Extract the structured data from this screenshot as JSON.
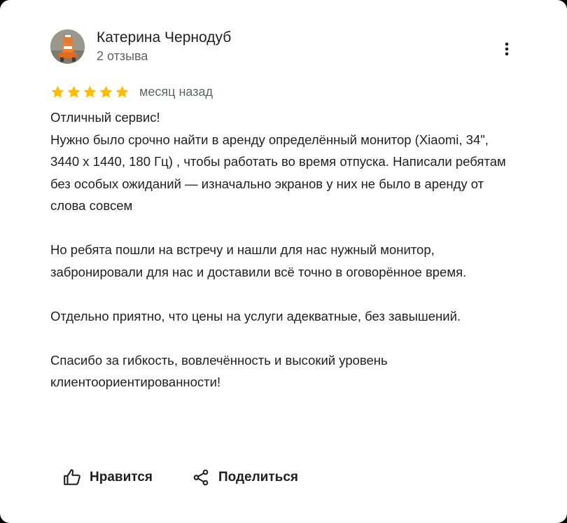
{
  "review": {
    "author": {
      "name": "Катерина Чернодуб",
      "reviews_count": "2 отзыва"
    },
    "rating": 5,
    "time": "месяц назад",
    "paragraphs": [
      {
        "lines": [
          "Отличный сервис!",
          "Нужно было срочно найти в аренду определённый монитор (Xiaomi, 34\", 3440 x 1440, 180 Гц) , чтобы работать во время отпуска. Написали ребятам без особых ожиданий — изначально экранов у них не было в аренду от слова совсем"
        ]
      },
      {
        "lines": [
          "Но ребята пошли на встречу и нашли для нас нужный монитор, забронировали для нас и доставили всё точно в оговорённое время."
        ]
      },
      {
        "lines": [
          "Отдельно приятно, что цены на услуги адекватные, без завышений."
        ]
      },
      {
        "lines": [
          "Спасибо за гибкость, вовлечённость и высокий уровень клиентоориентированности!"
        ]
      }
    ]
  },
  "actions": {
    "like_label": "Нравится",
    "share_label": "Поделиться"
  },
  "icons": {
    "more": "more-vertical-icon",
    "like": "thumb-up-icon",
    "share": "share-icon",
    "star": "star-icon"
  },
  "colors": {
    "star": "#fbbc04",
    "text": "#1f1f1f",
    "secondary_text": "#5f6368"
  }
}
